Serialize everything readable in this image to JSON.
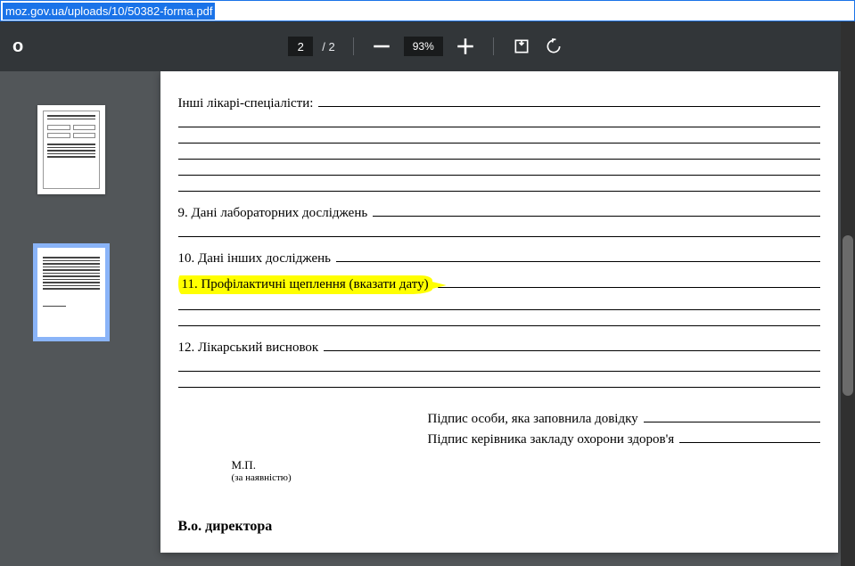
{
  "url": "moz.gov.ua/uploads/10/50382-forma.pdf",
  "toolbar": {
    "left_char": "о",
    "page_current": "2",
    "page_total": "/ 2",
    "zoom": "93%"
  },
  "doc": {
    "other_specialists": "Інші лікарі-спеціалісти:",
    "section9": "9. Дані лабораторних досліджень",
    "section10": "10. Дані інших досліджень",
    "section11": "11. Профілактичні  щеплення (вказати дату)",
    "section12": "12. Лікарський висновок",
    "sig1": "Підпис особи, яка заповнила довідку",
    "sig2": "Підпис керівника закладу охорони здоров'я",
    "mp": "М.П.",
    "mp_note": "(за наявністю)",
    "director": "В.о. директора"
  }
}
